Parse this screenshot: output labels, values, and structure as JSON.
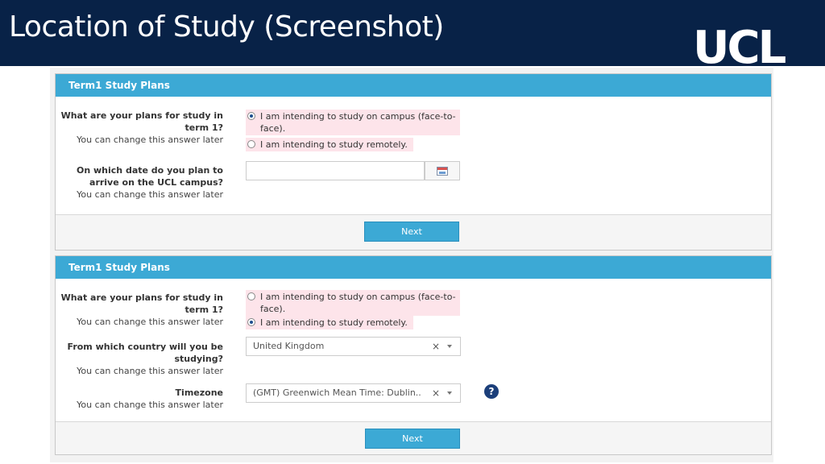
{
  "slide": {
    "title": "Location of Study (Screenshot)",
    "logo": "UCL"
  },
  "colors": {
    "header_bg": "#082247",
    "panel_header": "#3ca9d5",
    "selected_option_bg": "#fde4ea",
    "help_icon": "#1c3f7a"
  },
  "panel1": {
    "header": "Term1 Study Plans",
    "plans_question": "What are your plans for study in term 1?",
    "plans_hint": "You can change this answer later",
    "options": [
      {
        "label": "I am intending to study on campus (face-to-face).",
        "selected": true
      },
      {
        "label": "I am intending to study remotely.",
        "selected": false
      }
    ],
    "date_question": "On which date do you plan to arrive on the UCL campus?",
    "date_hint": "You can change this answer later",
    "date_value": "",
    "calendar_icon": "calendar-icon",
    "next_label": "Next"
  },
  "panel2": {
    "header": "Term1 Study Plans",
    "plans_question": "What are your plans for study in term 1?",
    "plans_hint": "You can change this answer later",
    "options": [
      {
        "label": "I am intending to study on campus (face-to-face).",
        "selected": false
      },
      {
        "label": "I am intending to study remotely.",
        "selected": true
      }
    ],
    "country_question": "From which country will you be studying?",
    "country_hint": "You can change this answer later",
    "country_value": "United Kingdom",
    "timezone_question": "Timezone",
    "timezone_hint": "You can change this answer later",
    "timezone_value": "(GMT) Greenwich Mean Time: Dublin..",
    "clear_symbol": "×",
    "help_symbol": "?",
    "next_label": "Next"
  }
}
